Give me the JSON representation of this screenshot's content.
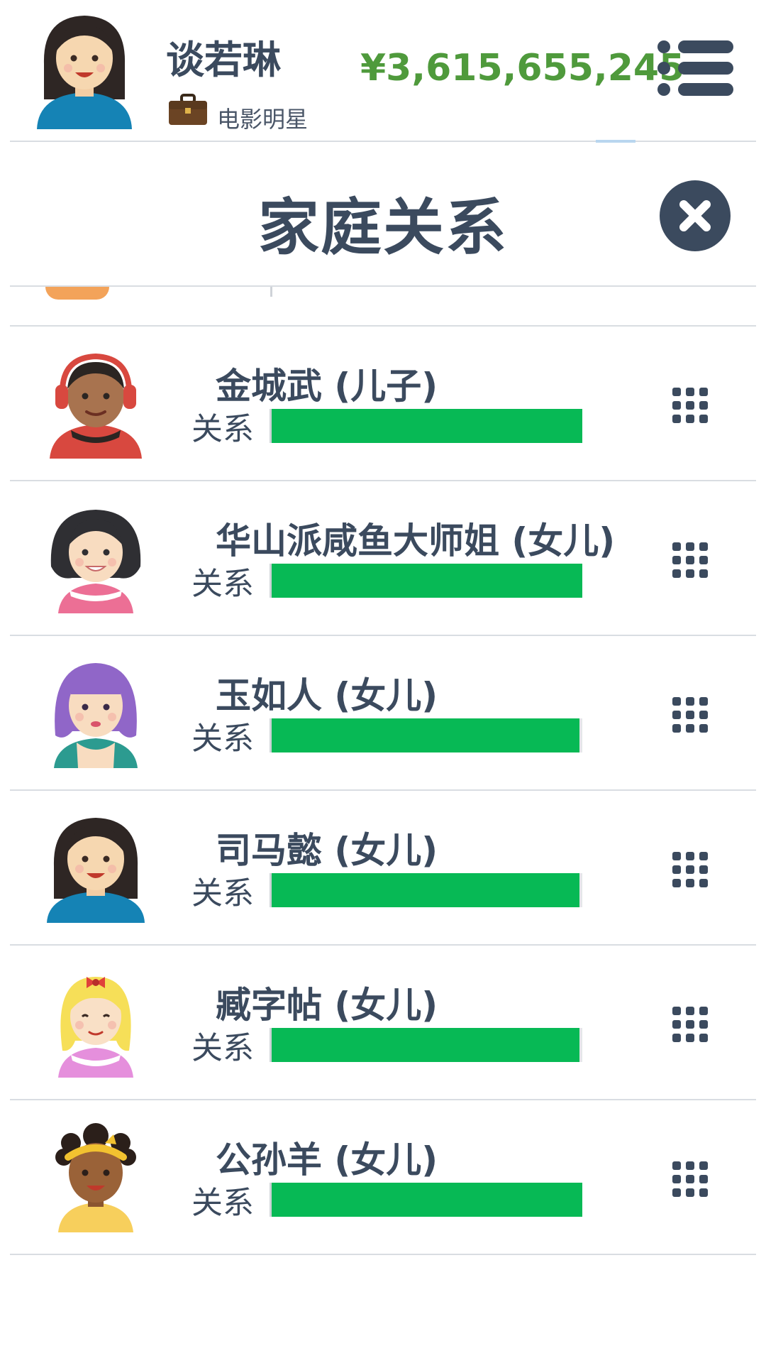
{
  "header": {
    "player_name": "谈若琳",
    "job_icon": "briefcase-icon",
    "job_title": "电影明星",
    "money": "¥3,615,655,245",
    "menu_icon": "list-menu-icon"
  },
  "dialog": {
    "title": "家庭关系",
    "close_icon": "close-icon"
  },
  "relationship_label": "关系",
  "family": [
    {
      "name": "金城武 (儿子)",
      "relationship_level": 100,
      "avatar": "boy-headphones-avatar"
    },
    {
      "name": "华山派咸鱼大师姐 (女儿)",
      "relationship_level": 100,
      "avatar": "girl-dark-hair-avatar"
    },
    {
      "name": "玉如人 (女儿)",
      "relationship_level": 99,
      "avatar": "girl-purple-hair-avatar"
    },
    {
      "name": "司马懿 (女儿)",
      "relationship_level": 99,
      "avatar": "girl-long-hair-avatar"
    },
    {
      "name": "臧字帖 (女儿)",
      "relationship_level": 99,
      "avatar": "girl-blonde-bow-avatar"
    },
    {
      "name": "公孙羊 (女儿)",
      "relationship_level": 100,
      "avatar": "girl-headband-avatar"
    }
  ],
  "colors": {
    "text": "#3b4a5e",
    "money": "#4f9a3c",
    "relationship_bar": "#07b955",
    "divider": "#d9dde2"
  }
}
